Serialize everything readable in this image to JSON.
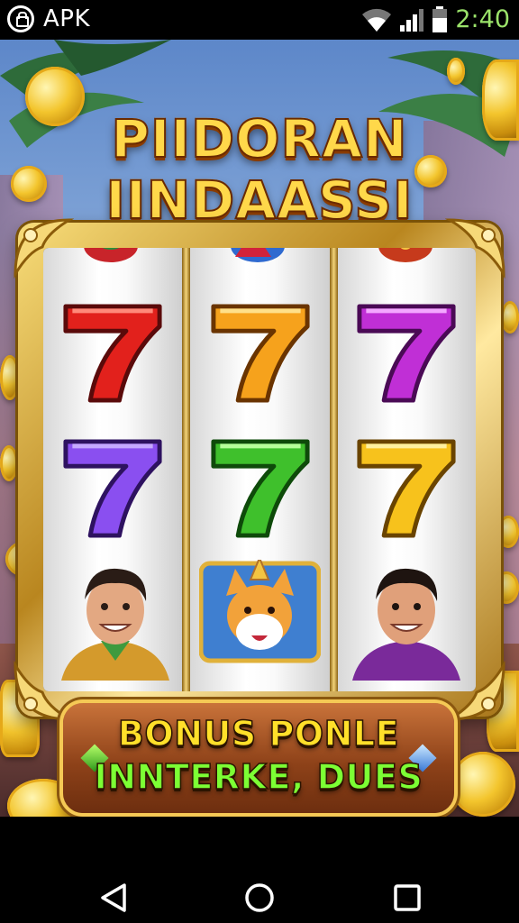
{
  "status_bar": {
    "app_label": "APK",
    "time": "2:40",
    "time_color": "#9be36a"
  },
  "game": {
    "title_line_1": "PIIDORAN",
    "title_line_2": "IINDAASSI",
    "reels": [
      {
        "symbols": [
          "red 7",
          "purple 7",
          "smiling man"
        ]
      },
      {
        "symbols": [
          "orange 7",
          "green 7",
          "party dog"
        ]
      },
      {
        "symbols": [
          "magenta 7",
          "yellow 7",
          "smiling man"
        ]
      }
    ],
    "bonus_button": {
      "line_1": "BONUS PONLE",
      "line_2": "INNTERKE, DUES"
    },
    "colors": {
      "gold": "#f3c52d",
      "title_yellow": "#ffd84a",
      "bonus_yellow": "#ffe02a",
      "bonus_green": "#7cff34",
      "button_brown": "#8e4219"
    }
  },
  "nav_bar": {
    "back_icon": "back-triangle",
    "home_icon": "home-circle",
    "recents_icon": "recents-square"
  }
}
